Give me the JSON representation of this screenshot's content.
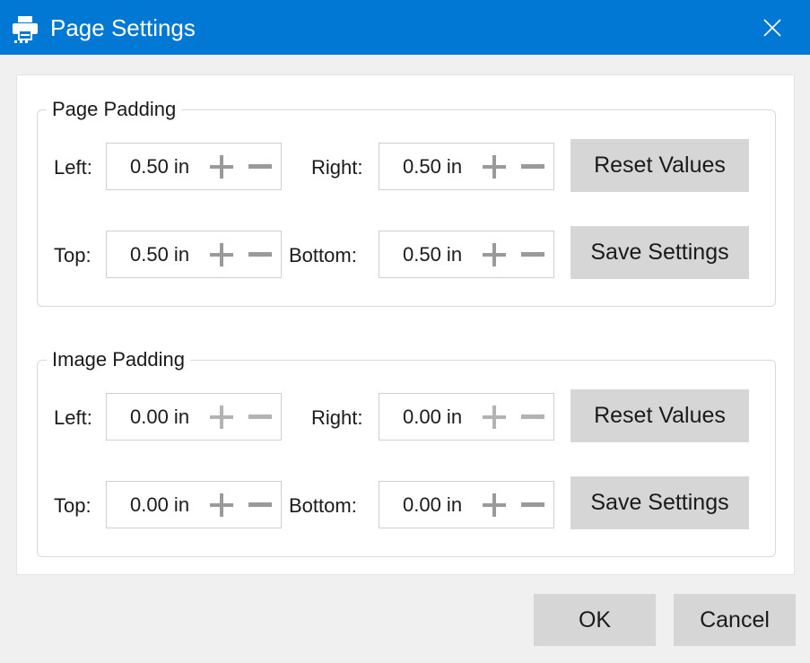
{
  "window": {
    "title": "Page Settings",
    "icon": "printer-icon",
    "accent_color": "#0078d4"
  },
  "page_padding": {
    "legend": "Page Padding",
    "left": {
      "label": "Left:",
      "value": "0.50 in"
    },
    "right": {
      "label": "Right:",
      "value": "0.50 in"
    },
    "top": {
      "label": "Top:",
      "value": "0.50 in"
    },
    "bottom": {
      "label": "Bottom:",
      "value": "0.50 in"
    },
    "reset_label": "Reset Values",
    "save_label": "Save Settings"
  },
  "image_padding": {
    "legend": "Image Padding",
    "left": {
      "label": "Left:",
      "value": "0.00 in"
    },
    "right": {
      "label": "Right:",
      "value": "0.00 in"
    },
    "top": {
      "label": "Top:",
      "value": "0.00 in"
    },
    "bottom": {
      "label": "Bottom:",
      "value": "0.00 in"
    },
    "reset_label": "Reset Values",
    "save_label": "Save Settings"
  },
  "footer": {
    "ok_label": "OK",
    "cancel_label": "Cancel"
  }
}
